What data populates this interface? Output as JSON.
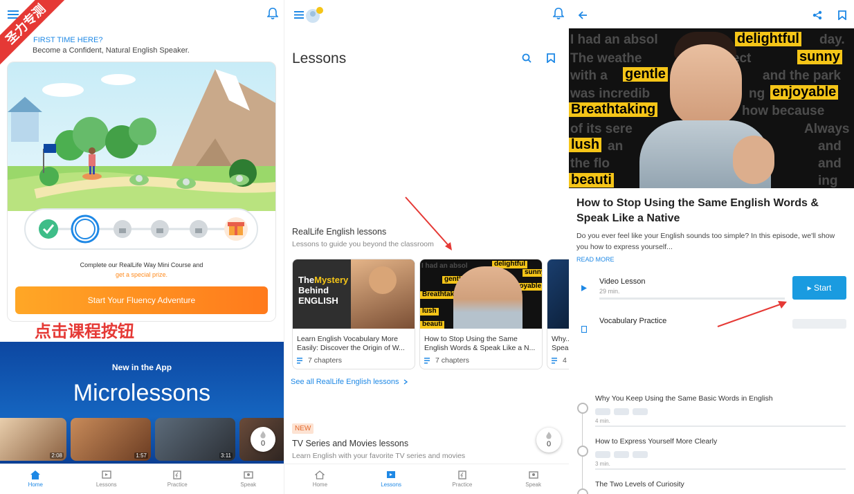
{
  "overlay": {
    "corner_badge": "圣力专测",
    "instruction": "点击课程按钮"
  },
  "home": {
    "first_time": "FIRST TIME HERE?",
    "subtitle": "Become a Confident, Natural English Speaker.",
    "course_text": "Complete our RealLife Way Mini Course and",
    "prize_text": "get a special prize.",
    "cta": "Start Your Fluency Adventure",
    "promo_kicker": "New in the App",
    "promo_title": "Microlessons",
    "videos": [
      {
        "duration": "2:08"
      },
      {
        "duration": "1:57"
      },
      {
        "duration": "3:11"
      }
    ],
    "streak": "0"
  },
  "nav": {
    "home": "Home",
    "lessons": "Lessons",
    "practice": "Practice",
    "speak": "Speak"
  },
  "lessons": {
    "title": "Lessons",
    "section_title": "RealLife English lessons",
    "section_sub": "Lessons to guide you beyond the classroom",
    "cards": [
      {
        "title": "Learn English Vocabulary More Easily: Discover the Origin of W...",
        "chapters": "7 chapters",
        "thumb_line1": "The",
        "thumb_word": "Mystery",
        "thumb_line2": "Behind",
        "thumb_line3": "ENGLISH"
      },
      {
        "title": "How to Stop Using the Same English Words & Speak Like a N...",
        "chapters": "7 chapters"
      },
      {
        "title": "Why... Speak...",
        "chapters": "4"
      }
    ],
    "see_all": "See all RealLife English lessons",
    "new_badge": "NEW",
    "tv_title": "TV Series and Movies lessons",
    "tv_sub": "Learn English with your favorite TV series and movies",
    "streak": "0"
  },
  "lesson_detail": {
    "hero_words": [
      "delightful",
      "sunny",
      "gentle",
      "enjoyable",
      "Breathtaking",
      "lush",
      "beauti"
    ],
    "hero_ghost": [
      "I had an absol",
      "day.",
      "The  weathe",
      "perfect",
      "with a",
      "and the park",
      "was incredib",
      "ng",
      "how because",
      "of its sere",
      "Always",
      "an",
      "and",
      "the flo",
      "and",
      "ing"
    ],
    "title": "How to Stop Using the Same English Words & Speak Like a Native",
    "description": "Do you ever feel like your English sounds too simple? In this episode, we'll show you how to express yourself...",
    "read_more": "READ MORE",
    "video_label": "Video Lesson",
    "video_duration": "29 min.",
    "start": "▸ Start",
    "vocab_label": "Vocabulary Practice",
    "timeline": [
      {
        "title": "Why You Keep Using the Same Basic Words in English",
        "duration": "4 min."
      },
      {
        "title": "How to Express Yourself More Clearly",
        "duration": "3 min."
      },
      {
        "title": "The Two Levels of Curiosity",
        "duration": ""
      }
    ]
  },
  "colors": {
    "accent": "#1e88e5",
    "orange": "#ff8a1c",
    "start": "#1a9be0",
    "highlight": "#f5c518",
    "red": "#e53935"
  }
}
